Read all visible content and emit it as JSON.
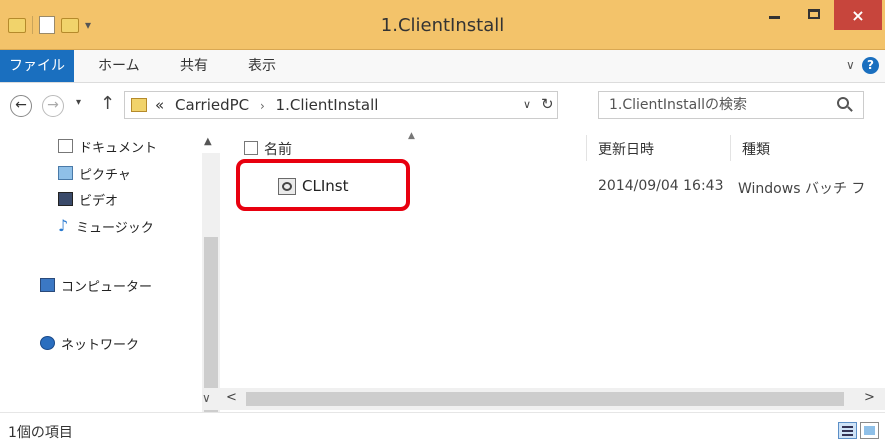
{
  "window": {
    "title": "1.ClientInstall"
  },
  "title_controls": {
    "close_label": "×"
  },
  "ribbon": {
    "tabs": [
      {
        "label": "ファイル"
      },
      {
        "label": "ホーム"
      },
      {
        "label": "共有"
      },
      {
        "label": "表示"
      }
    ],
    "expand_label": "∨",
    "help_label": "?"
  },
  "navigation": {
    "back_label": "←",
    "forward_label": "→",
    "recent_label": "▾",
    "up_label": "↑",
    "address": {
      "prefix": "«",
      "segments": [
        "CarriedPC",
        "1.ClientInstall"
      ],
      "separator": "›"
    },
    "dropdown_label": "∨",
    "refresh_label": "↻",
    "search_placeholder": "1.ClientInstallの検索"
  },
  "nav_pane": {
    "items": [
      {
        "label": "ドキュメント",
        "icon": "document-icon"
      },
      {
        "label": "ピクチャ",
        "icon": "pictures-icon"
      },
      {
        "label": "ビデオ",
        "icon": "video-icon"
      },
      {
        "label": "ミュージック",
        "icon": "music-icon"
      },
      {
        "label": "コンピューター",
        "icon": "computer-icon"
      },
      {
        "label": "ネットワーク",
        "icon": "network-icon"
      }
    ]
  },
  "file_list": {
    "columns": [
      {
        "label": "名前"
      },
      {
        "label": "更新日時"
      },
      {
        "label": "種類"
      }
    ],
    "rows": [
      {
        "name": "CLInst",
        "modified": "2014/09/04 16:43",
        "type": "Windows バッチ フ"
      }
    ]
  },
  "status_bar": {
    "item_count": "1個の項目"
  },
  "colors": {
    "title_bar": "#f3c36a",
    "file_tab": "#1a6fbf",
    "close_button": "#c7453c",
    "highlight": "#e8000f"
  }
}
